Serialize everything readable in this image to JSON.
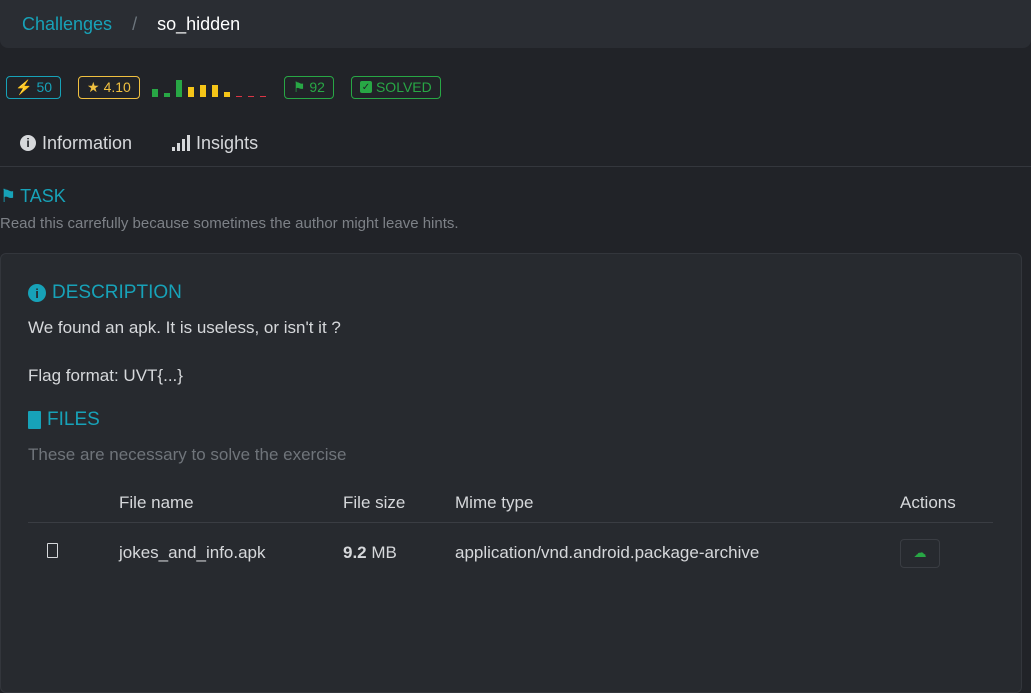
{
  "breadcrumb": {
    "parent": "Challenges",
    "separator": "/",
    "current": "so_hidden"
  },
  "badges": {
    "points": "50",
    "rating": "4.10",
    "solves": "92",
    "status": "SOLVED"
  },
  "rating_distribution": {
    "values": [
      8,
      4,
      17,
      10,
      12,
      12,
      5,
      1,
      1,
      1
    ],
    "colors": [
      "#28a745",
      "#28a745",
      "#28a745",
      "#f5c518",
      "#f5c518",
      "#f5c518",
      "#f5c518",
      "#dc3545",
      "#dc3545",
      "#dc3545"
    ]
  },
  "tabs": [
    {
      "label": "Information"
    },
    {
      "label": "Insights"
    }
  ],
  "task": {
    "title": "TASK",
    "subtitle": "Read this carrefully because sometimes the author might leave hints."
  },
  "description": {
    "title": "DESCRIPTION",
    "lines": [
      "We found an apk. It is useless, or isn't it ?",
      "Flag format: UVT{...}"
    ]
  },
  "files": {
    "title": "FILES",
    "subtitle": "These are necessary to solve the exercise",
    "columns": [
      "File name",
      "File size",
      "Mime type",
      "Actions"
    ],
    "rows": [
      {
        "name": "jokes_and_info.apk",
        "size_value": "9.2",
        "size_unit": "MB",
        "mime": "application/vnd.android.package-archive"
      }
    ]
  },
  "colors": {
    "accent": "#17a2b8",
    "success": "#28a745",
    "warning": "#f0c040"
  }
}
